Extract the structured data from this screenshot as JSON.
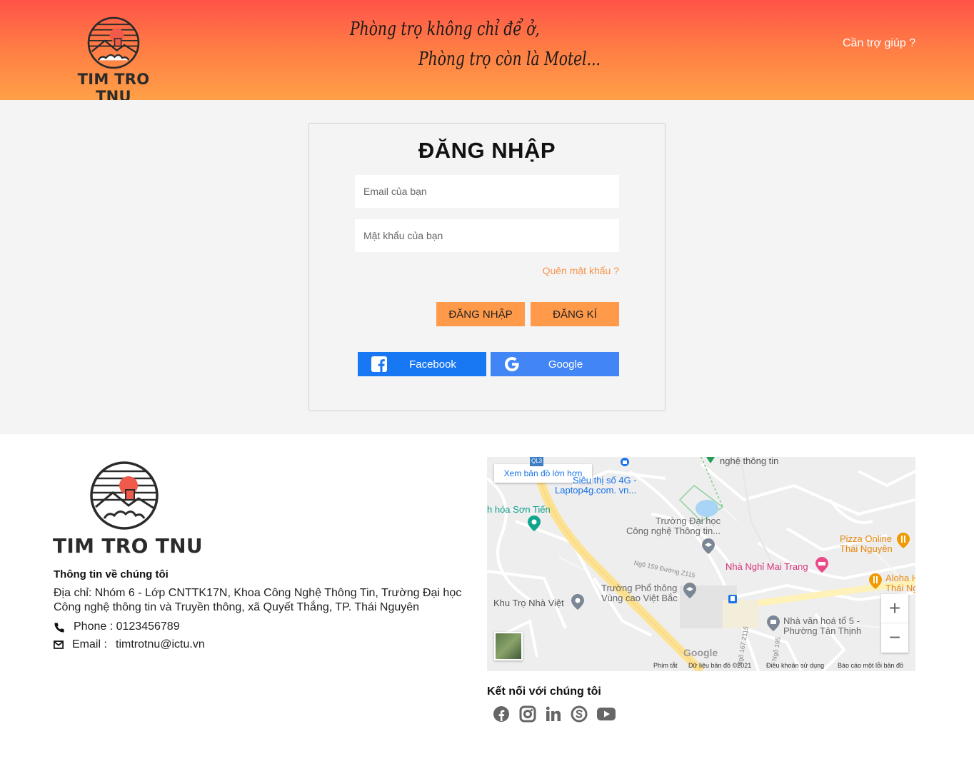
{
  "header": {
    "logo_text": "TIM TRO TNU",
    "slogan_line1": "Phòng trọ không chỉ để ở,",
    "slogan_line2": "Phòng trọ còn là Motel...",
    "help_link": "Cần trợ giúp ?"
  },
  "login": {
    "title": "ĐĂNG NHẬP",
    "email_placeholder": "Email của bạn",
    "password_placeholder": "Mật khẩu của bạn",
    "forgot_link": "Quên mật khẩu ?",
    "login_button": "ĐĂNG NHẬP",
    "register_button": "ĐĂNG KÍ",
    "facebook_button": "Facebook",
    "google_button": "Google",
    "facebook_color": "#1877f2",
    "google_color": "#4285f4",
    "button_color": "#ff9a4a"
  },
  "footer": {
    "logo_text": "TIM TRO TNU",
    "about_heading": "Thông tin về chúng tôi",
    "address": "Địa chỉ: Nhóm 6 - Lớp CNTTK17N, Khoa Công Nghệ Thông Tin, Trường Đại học Công nghệ thông tin và Truyền thông, xã Quyết Thắng, TP. Thái Nguyên",
    "phone_label": "Phone : 0123456789",
    "email_label": "Email :",
    "email_value": "timtrotnu@ictu.vn",
    "connect_heading": "Kết nối với chúng tôi",
    "social_icons": [
      "facebook-icon",
      "instagram-icon",
      "linkedin-icon",
      "skype-icon",
      "youtube-icon"
    ]
  },
  "map": {
    "view_larger": "Xem bản đồ lớn hơn",
    "labels": {
      "it_school_top": "nghệ thông tin",
      "laptop": "Laptop4g.com. vn...",
      "laptop_top": "Siêu thị số 4G -",
      "son_tien": "h hóa Sơn Tiến",
      "university_1": "Trường Đại học",
      "university_2": "Công nghệ Thông tin...",
      "pizza_1": "Pizza Online",
      "pizza_2": "Thái Nguyên",
      "guesthouse": "Nhà Nghỉ Mai Trang",
      "aloha_1": "Aloha H",
      "aloha_2": "Thái Ng",
      "school_1": "Trường Phổ thông",
      "school_2": "Vùng cao Việt Bắc",
      "khu_tro": "Khu Trọ Nhà Việt",
      "culture_1": "Nhà văn hoá tổ 5 -",
      "culture_2": "Phường Tân Thịnh",
      "road_159": "Ngõ 159 Đường Z115",
      "road_167": "Ngõ 167 Z115",
      "road_195": "Ngõ 195",
      "ql3": "QL3",
      "google": "Google"
    },
    "attribution": {
      "shortcuts": "Phím tắt",
      "data": "Dữ liệu bản đồ ©2021",
      "terms": "Điều khoản sử dụng",
      "report": "Báo cáo một lỗi bản đồ"
    }
  }
}
